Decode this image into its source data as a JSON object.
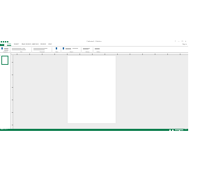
{
  "window": {
    "title": "Publication1 - Publisher",
    "controls": [
      "?",
      "—",
      "❐",
      "✕"
    ]
  },
  "quick_access": [
    "save-icon",
    "undo-icon",
    "redo-icon",
    "customize-icon"
  ],
  "ribbon": {
    "tabs": [
      {
        "label": "FILE"
      },
      {
        "label": "HOME"
      },
      {
        "label": "INSERT"
      },
      {
        "label": "PAGE DESIGN"
      },
      {
        "label": "MAILINGS"
      },
      {
        "label": "REVIEW"
      },
      {
        "label": "VIEW"
      }
    ],
    "active_tab": "HOME",
    "user": "Sign in",
    "groups": [
      {
        "label": "Clipboard"
      },
      {
        "label": "Font"
      },
      {
        "label": "Paragraph"
      },
      {
        "label": "Styles"
      },
      {
        "label": "Objects"
      },
      {
        "label": "Arrange"
      },
      {
        "label": "Editing"
      }
    ]
  },
  "nav_pane": {
    "page_number": "1"
  },
  "status_bar": {
    "page": "PAGE: 1 OF 1",
    "zoom": "52%",
    "zoom_level": 0.52
  },
  "colors": {
    "accent": "#0d7e4e",
    "workspace": "#ededed",
    "page": "#ffffff"
  }
}
